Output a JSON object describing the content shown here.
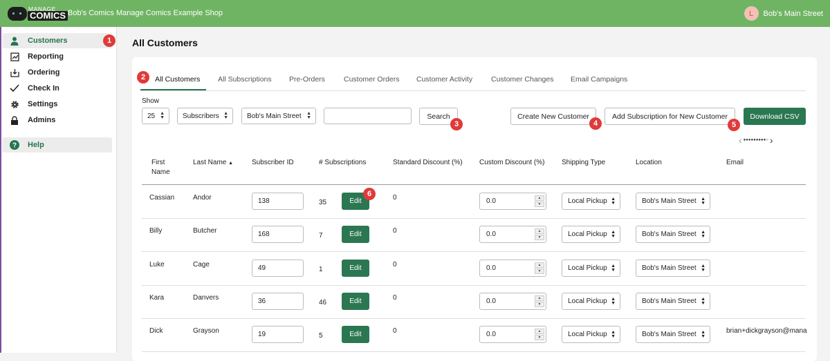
{
  "header": {
    "logo_top": "MANAGE",
    "logo_bottom": "COMICS",
    "shop_title": "Bob's Comics Manage Comics Example Shop",
    "user_initial": "L",
    "user_name": "Bob's Main Street"
  },
  "sidebar": {
    "items": [
      {
        "label": "Customers",
        "icon": "person-icon",
        "active": true
      },
      {
        "label": "Reporting",
        "icon": "report-icon"
      },
      {
        "label": "Ordering",
        "icon": "download-box-icon"
      },
      {
        "label": "Check In",
        "icon": "check-icon"
      },
      {
        "label": "Settings",
        "icon": "gear-icon"
      },
      {
        "label": "Admins",
        "icon": "lock-icon"
      },
      {
        "label": "Help",
        "icon": "help-icon"
      }
    ]
  },
  "page": {
    "title": "All Customers"
  },
  "tabs": [
    "All Customers",
    "All Subscriptions",
    "Pre-Orders",
    "Customer Orders",
    "Customer Activity",
    "Customer Changes",
    "Email Campaigns"
  ],
  "toolbar": {
    "show_label": "Show",
    "page_size": "25",
    "filter_type": "Subscribers",
    "location": "Bob's Main Street",
    "search_value": "",
    "search_label": "Search",
    "create_label": "Create New Customer",
    "add_sub_label": "Add Subscription for New Customer",
    "download_label": "Download CSV"
  },
  "pager": {
    "prev": "‹",
    "dots": "●●●●●●●●●○",
    "next": "›"
  },
  "table": {
    "headers": {
      "first_name_1": "First",
      "first_name_2": "Name",
      "last_name": "Last Name",
      "sort_indicator": "▲",
      "subscriber_id": "Subscriber ID",
      "subscriptions": "# Subscriptions",
      "standard_discount": "Standard Discount (%)",
      "custom_discount": "Custom Discount (%)",
      "shipping_type": "Shipping Type",
      "location": "Location",
      "email": "Email"
    },
    "edit_label": "Edit",
    "rows": [
      {
        "first": "Cassian",
        "last": "Andor",
        "id": "138",
        "subs": "35",
        "std": "0",
        "custom": "0.0",
        "shipping": "Local Pickup",
        "location": "Bob's Main Street",
        "email": ""
      },
      {
        "first": "Billy",
        "last": "Butcher",
        "id": "168",
        "subs": "7",
        "std": "0",
        "custom": "0.0",
        "shipping": "Local Pickup",
        "location": "Bob's Main Street",
        "email": ""
      },
      {
        "first": "Luke",
        "last": "Cage",
        "id": "49",
        "subs": "1",
        "std": "0",
        "custom": "0.0",
        "shipping": "Local Pickup",
        "location": "Bob's Main Street",
        "email": ""
      },
      {
        "first": "Kara",
        "last": "Danvers",
        "id": "36",
        "subs": "46",
        "std": "0",
        "custom": "0.0",
        "shipping": "Local Pickup",
        "location": "Bob's Main Street",
        "email": ""
      },
      {
        "first": "Dick",
        "last": "Grayson",
        "id": "19",
        "subs": "5",
        "std": "0",
        "custom": "0.0",
        "shipping": "Local Pickup",
        "location": "Bob's Main Street",
        "email": "brian+dickgrayson@mana"
      }
    ]
  },
  "markers": [
    "1",
    "2",
    "3",
    "4",
    "5",
    "6"
  ],
  "colors": {
    "header_green": "#6fb463",
    "button_green": "#2b7752",
    "badge_red": "#e03a3a"
  }
}
